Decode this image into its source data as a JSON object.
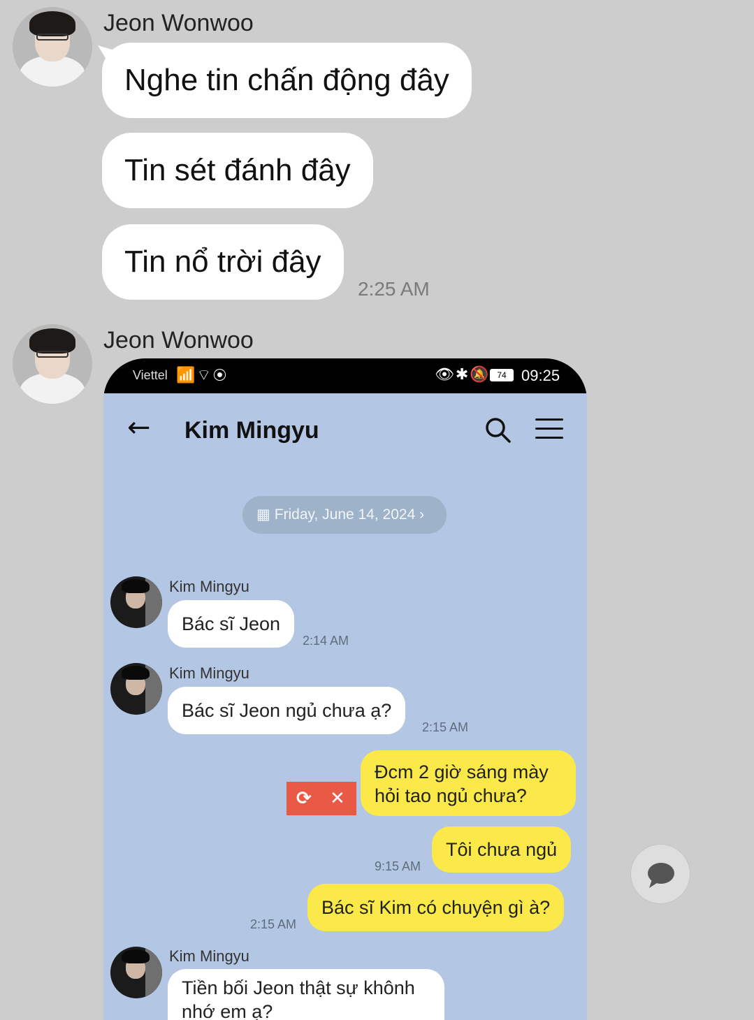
{
  "messages_top": {
    "sender": "Jeon Wonwoo",
    "bubbles": [
      "Nghe tin chấn động đây",
      "Tin sét đánh đây",
      "Tin nổ trời đây"
    ],
    "time": "2:25 AM"
  },
  "message_image": {
    "sender": "Jeon Wonwoo"
  },
  "screenshot": {
    "statusbar": {
      "carrier": "Viettel",
      "signal_icons": "📶⌔◉",
      "right_icons": "👁✱🔕",
      "battery": "74",
      "clock": "09:25"
    },
    "appbar": {
      "back_icon": "←",
      "title": "Kim Mingyu",
      "search_icon": "search-icon",
      "menu_icon": "menu-icon"
    },
    "date_pill": "Friday, June 14, 2024",
    "chat": {
      "incoming1": {
        "name": "Kim Mingyu",
        "text": "Bác sĩ Jeon",
        "time": "2:14 AM"
      },
      "incoming2": {
        "name": "Kim Mingyu",
        "text": "Bác sĩ Jeon ngủ chưa ạ?",
        "time": "2:15 AM"
      },
      "outgoing1": {
        "line1": "Đcm 2 giờ sáng mày",
        "line2": "hỏi tao ngủ chưa?"
      },
      "retry_icon": "⟳",
      "delete_icon": "✕",
      "outgoing2": {
        "text": "Tôi chưa ngủ",
        "time": "9:15 AM"
      },
      "outgoing3": {
        "text": "Bác sĩ Kim có chuyện gì à?",
        "time": "2:15 AM"
      },
      "incoming3": {
        "name": "Kim Mingyu",
        "text": "Tiền bối Jeon thật sự khônh nhớ em ạ?"
      }
    }
  },
  "colors": {
    "background": "#cdcdcd",
    "chat_bg": "#b3c6e3",
    "outgoing_bubble": "#fbe94a",
    "retry_bg": "#e85a45"
  }
}
